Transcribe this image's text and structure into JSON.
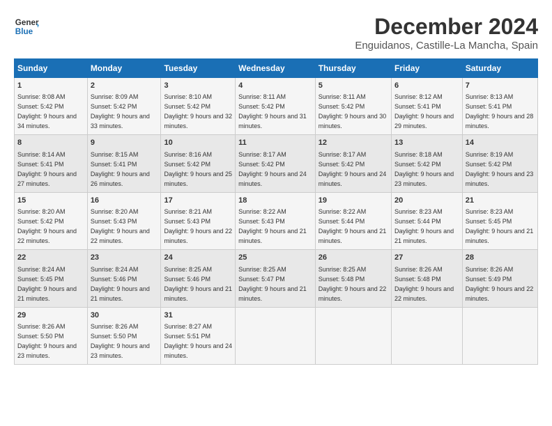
{
  "logo": {
    "line1": "General",
    "line2": "Blue"
  },
  "title": "December 2024",
  "location": "Enguidanos, Castille-La Mancha, Spain",
  "days_of_week": [
    "Sunday",
    "Monday",
    "Tuesday",
    "Wednesday",
    "Thursday",
    "Friday",
    "Saturday"
  ],
  "weeks": [
    [
      {
        "num": "1",
        "sunrise": "8:08 AM",
        "sunset": "5:42 PM",
        "daylight": "9 hours and 34 minutes."
      },
      {
        "num": "2",
        "sunrise": "8:09 AM",
        "sunset": "5:42 PM",
        "daylight": "9 hours and 33 minutes."
      },
      {
        "num": "3",
        "sunrise": "8:10 AM",
        "sunset": "5:42 PM",
        "daylight": "9 hours and 32 minutes."
      },
      {
        "num": "4",
        "sunrise": "8:11 AM",
        "sunset": "5:42 PM",
        "daylight": "9 hours and 31 minutes."
      },
      {
        "num": "5",
        "sunrise": "8:11 AM",
        "sunset": "5:42 PM",
        "daylight": "9 hours and 30 minutes."
      },
      {
        "num": "6",
        "sunrise": "8:12 AM",
        "sunset": "5:41 PM",
        "daylight": "9 hours and 29 minutes."
      },
      {
        "num": "7",
        "sunrise": "8:13 AM",
        "sunset": "5:41 PM",
        "daylight": "9 hours and 28 minutes."
      }
    ],
    [
      {
        "num": "8",
        "sunrise": "8:14 AM",
        "sunset": "5:41 PM",
        "daylight": "9 hours and 27 minutes."
      },
      {
        "num": "9",
        "sunrise": "8:15 AM",
        "sunset": "5:41 PM",
        "daylight": "9 hours and 26 minutes."
      },
      {
        "num": "10",
        "sunrise": "8:16 AM",
        "sunset": "5:42 PM",
        "daylight": "9 hours and 25 minutes."
      },
      {
        "num": "11",
        "sunrise": "8:17 AM",
        "sunset": "5:42 PM",
        "daylight": "9 hours and 24 minutes."
      },
      {
        "num": "12",
        "sunrise": "8:17 AM",
        "sunset": "5:42 PM",
        "daylight": "9 hours and 24 minutes."
      },
      {
        "num": "13",
        "sunrise": "8:18 AM",
        "sunset": "5:42 PM",
        "daylight": "9 hours and 23 minutes."
      },
      {
        "num": "14",
        "sunrise": "8:19 AM",
        "sunset": "5:42 PM",
        "daylight": "9 hours and 23 minutes."
      }
    ],
    [
      {
        "num": "15",
        "sunrise": "8:20 AM",
        "sunset": "5:42 PM",
        "daylight": "9 hours and 22 minutes."
      },
      {
        "num": "16",
        "sunrise": "8:20 AM",
        "sunset": "5:43 PM",
        "daylight": "9 hours and 22 minutes."
      },
      {
        "num": "17",
        "sunrise": "8:21 AM",
        "sunset": "5:43 PM",
        "daylight": "9 hours and 22 minutes."
      },
      {
        "num": "18",
        "sunrise": "8:22 AM",
        "sunset": "5:43 PM",
        "daylight": "9 hours and 21 minutes."
      },
      {
        "num": "19",
        "sunrise": "8:22 AM",
        "sunset": "5:44 PM",
        "daylight": "9 hours and 21 minutes."
      },
      {
        "num": "20",
        "sunrise": "8:23 AM",
        "sunset": "5:44 PM",
        "daylight": "9 hours and 21 minutes."
      },
      {
        "num": "21",
        "sunrise": "8:23 AM",
        "sunset": "5:45 PM",
        "daylight": "9 hours and 21 minutes."
      }
    ],
    [
      {
        "num": "22",
        "sunrise": "8:24 AM",
        "sunset": "5:45 PM",
        "daylight": "9 hours and 21 minutes."
      },
      {
        "num": "23",
        "sunrise": "8:24 AM",
        "sunset": "5:46 PM",
        "daylight": "9 hours and 21 minutes."
      },
      {
        "num": "24",
        "sunrise": "8:25 AM",
        "sunset": "5:46 PM",
        "daylight": "9 hours and 21 minutes."
      },
      {
        "num": "25",
        "sunrise": "8:25 AM",
        "sunset": "5:47 PM",
        "daylight": "9 hours and 21 minutes."
      },
      {
        "num": "26",
        "sunrise": "8:25 AM",
        "sunset": "5:48 PM",
        "daylight": "9 hours and 22 minutes."
      },
      {
        "num": "27",
        "sunrise": "8:26 AM",
        "sunset": "5:48 PM",
        "daylight": "9 hours and 22 minutes."
      },
      {
        "num": "28",
        "sunrise": "8:26 AM",
        "sunset": "5:49 PM",
        "daylight": "9 hours and 22 minutes."
      }
    ],
    [
      {
        "num": "29",
        "sunrise": "8:26 AM",
        "sunset": "5:50 PM",
        "daylight": "9 hours and 23 minutes."
      },
      {
        "num": "30",
        "sunrise": "8:26 AM",
        "sunset": "5:50 PM",
        "daylight": "9 hours and 23 minutes."
      },
      {
        "num": "31",
        "sunrise": "8:27 AM",
        "sunset": "5:51 PM",
        "daylight": "9 hours and 24 minutes."
      },
      null,
      null,
      null,
      null
    ]
  ]
}
